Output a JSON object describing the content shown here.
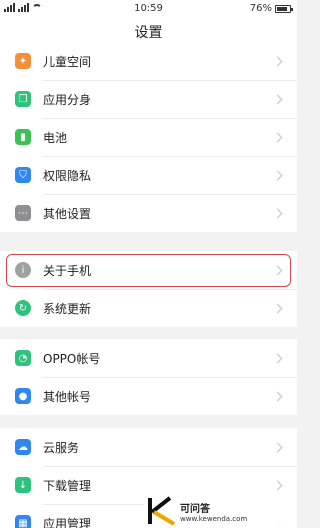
{
  "status_bar": {
    "time": "10:59",
    "battery": "76%"
  },
  "title": "设置",
  "groups": [
    {
      "items": [
        {
          "label": "儿童空间",
          "icon": "child-icon",
          "color": "#f3903a"
        },
        {
          "label": "应用分身",
          "icon": "app-clone-icon",
          "color": "#2ec27e"
        },
        {
          "label": "电池",
          "icon": "battery-icon",
          "color": "#3cbf55"
        },
        {
          "label": "权限隐私",
          "icon": "shield-icon",
          "color": "#2f88f0"
        },
        {
          "label": "其他设置",
          "icon": "more-icon",
          "color": "#8e8e93"
        }
      ]
    },
    {
      "items": [
        {
          "label": "关于手机",
          "icon": "info-icon",
          "color": "#a0a0a0"
        },
        {
          "label": "系统更新",
          "icon": "update-icon",
          "color": "#2ec27e"
        }
      ]
    },
    {
      "items": [
        {
          "label": "OPPO帐号",
          "icon": "account-icon",
          "color": "#2ec27e"
        },
        {
          "label": "其他帐号",
          "icon": "person-icon",
          "color": "#2f88f0"
        }
      ]
    },
    {
      "items": [
        {
          "label": "云服务",
          "icon": "cloud-icon",
          "color": "#2f88f0"
        },
        {
          "label": "下载管理",
          "icon": "download-icon",
          "color": "#2ec27e"
        },
        {
          "label": "应用管理",
          "icon": "apps-icon",
          "color": "#2f88f0"
        }
      ]
    }
  ],
  "watermark": {
    "title": "可问答",
    "url": "www.kewenda.com",
    "logo": "K"
  }
}
